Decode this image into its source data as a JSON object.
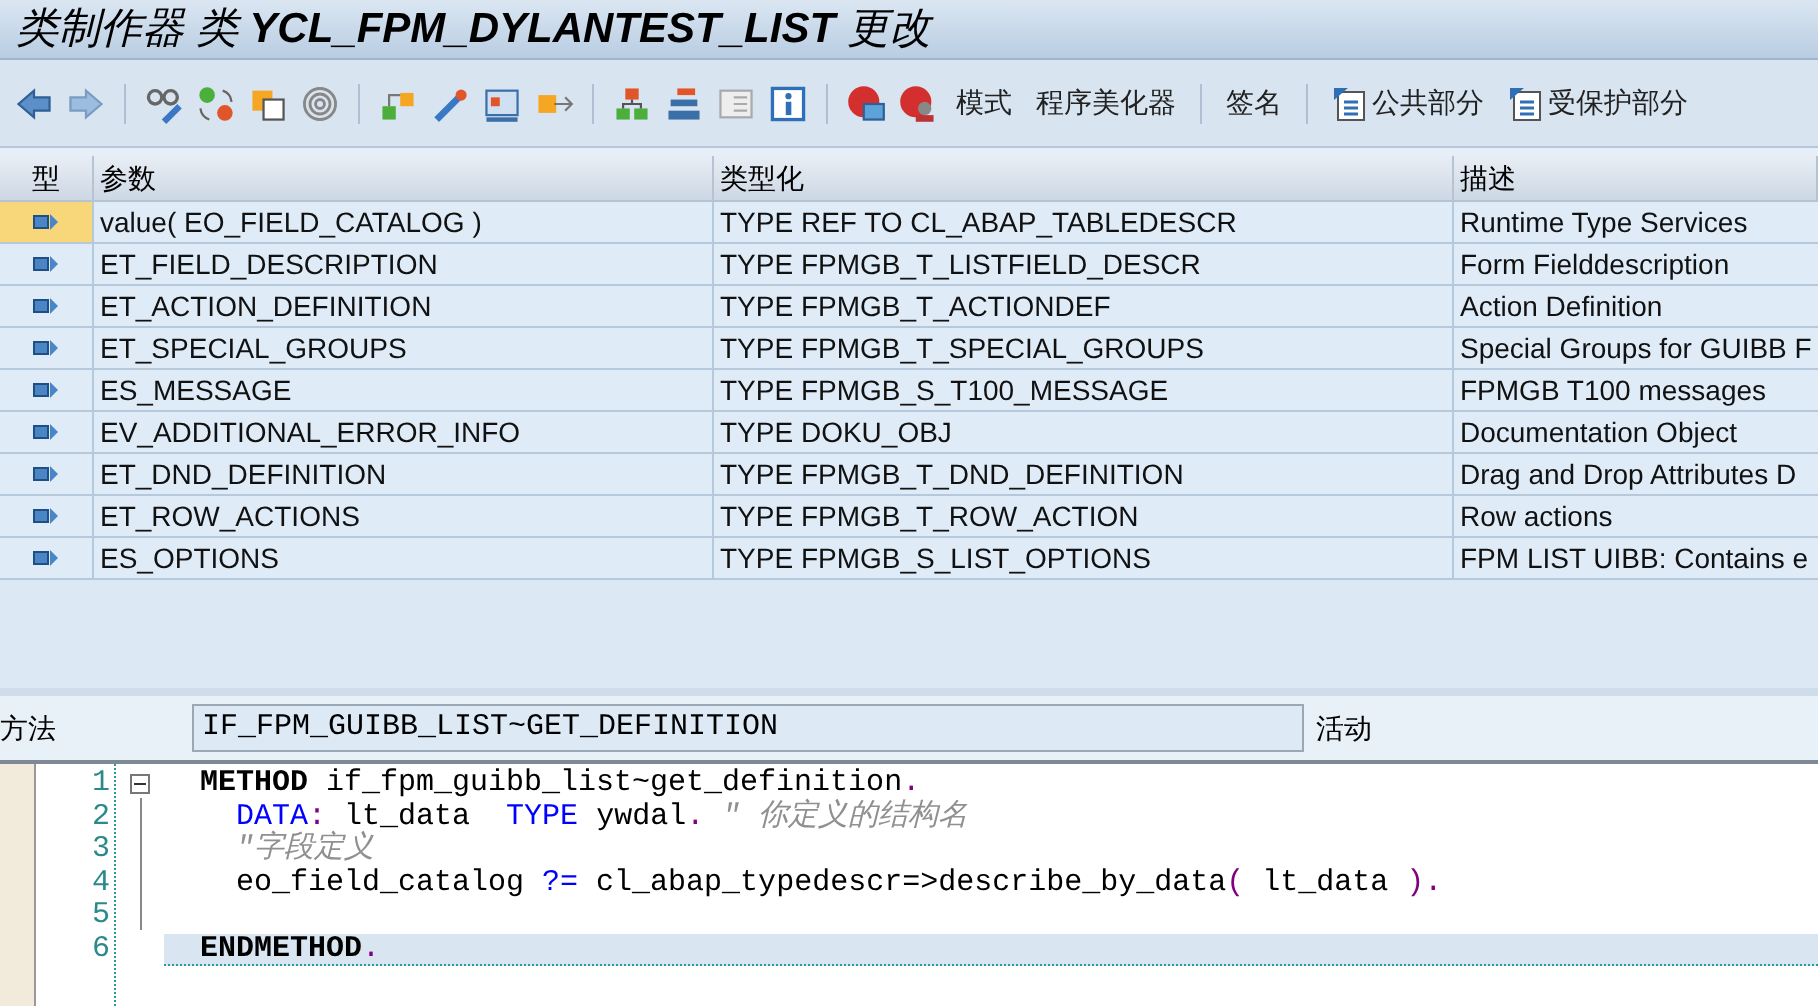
{
  "window": {
    "title": "类制作器 类 **YCL_FPM_DYLANTEST_LIST** 更改"
  },
  "toolbar": {
    "buttons": [
      {
        "label": "模式",
        "kind": "text"
      },
      {
        "label": "程序美化器",
        "kind": "text"
      },
      {
        "label": "签名",
        "kind": "text"
      },
      {
        "label": "公共部分",
        "kind": "document"
      },
      {
        "label": "受保护部分",
        "kind": "document"
      }
    ]
  },
  "table": {
    "columns": [
      "型",
      "参数",
      "类型化",
      "描述"
    ],
    "rows": [
      {
        "name": "value( EO_FIELD_CATALOG )",
        "typing": "TYPE REF TO CL_ABAP_TABLEDESCR",
        "description": "Runtime Type Services",
        "selected": true
      },
      {
        "name": "ET_FIELD_DESCRIPTION",
        "typing": "TYPE FPMGB_T_LISTFIELD_DESCR",
        "description": "Form Fielddescription",
        "selected": false
      },
      {
        "name": "ET_ACTION_DEFINITION",
        "typing": "TYPE FPMGB_T_ACTIONDEF",
        "description": "Action Definition",
        "selected": false
      },
      {
        "name": "ET_SPECIAL_GROUPS",
        "typing": "TYPE FPMGB_T_SPECIAL_GROUPS",
        "description": "Special Groups for GUIBB F",
        "selected": false
      },
      {
        "name": "ES_MESSAGE",
        "typing": "TYPE FPMGB_S_T100_MESSAGE",
        "description": "FPMGB T100 messages",
        "selected": false
      },
      {
        "name": "EV_ADDITIONAL_ERROR_INFO",
        "typing": "TYPE DOKU_OBJ",
        "description": "Documentation Object",
        "selected": false
      },
      {
        "name": "ET_DND_DEFINITION",
        "typing": "TYPE FPMGB_T_DND_DEFINITION",
        "description": "Drag and Drop Attributes D",
        "selected": false
      },
      {
        "name": "ET_ROW_ACTIONS",
        "typing": "TYPE FPMGB_T_ROW_ACTION",
        "description": "Row actions",
        "selected": false
      },
      {
        "name": "ES_OPTIONS",
        "typing": "TYPE FPMGB_S_LIST_OPTIONS",
        "description": "FPM LIST UIBB: Contains e",
        "selected": false
      }
    ]
  },
  "method_bar": {
    "label": "方法",
    "value": "IF_FPM_GUIBB_LIST~GET_DEFINITION",
    "status": "活动"
  },
  "editor": {
    "lines": [
      {
        "number": "1",
        "current": false,
        "tokens": [
          {
            "kind": "bold",
            "text": "METHOD"
          },
          {
            "kind": "plain",
            "text": " if_fpm_guibb_list~get_definition"
          },
          {
            "kind": "punct",
            "text": "."
          }
        ]
      },
      {
        "number": "2",
        "current": false,
        "tokens": [
          {
            "kind": "keyword",
            "text": "  DATA"
          },
          {
            "kind": "punct",
            "text": ":"
          },
          {
            "kind": "plain",
            "text": " lt_data  "
          },
          {
            "kind": "keyword",
            "text": "TYPE"
          },
          {
            "kind": "plain",
            "text": " ywdal"
          },
          {
            "kind": "punct",
            "text": ". "
          },
          {
            "kind": "comment",
            "text": "\" 你定义的结构名"
          }
        ]
      },
      {
        "number": "3",
        "current": false,
        "tokens": [
          {
            "kind": "comment",
            "text": "  \"字段定义"
          }
        ]
      },
      {
        "number": "4",
        "current": false,
        "tokens": [
          {
            "kind": "plain",
            "text": "  eo_field_catalog "
          },
          {
            "kind": "keyword",
            "text": "?="
          },
          {
            "kind": "plain",
            "text": " cl_abap_typedescr=>describe_by_data"
          },
          {
            "kind": "punct",
            "text": "("
          },
          {
            "kind": "plain",
            "text": " lt_data "
          },
          {
            "kind": "punct",
            "text": ")."
          }
        ]
      },
      {
        "number": "5",
        "current": false
      },
      {
        "number": "6",
        "current": true,
        "tokens": [
          {
            "kind": "bold",
            "text": "ENDMETHOD"
          },
          {
            "kind": "punct",
            "text": "."
          }
        ]
      }
    ]
  }
}
